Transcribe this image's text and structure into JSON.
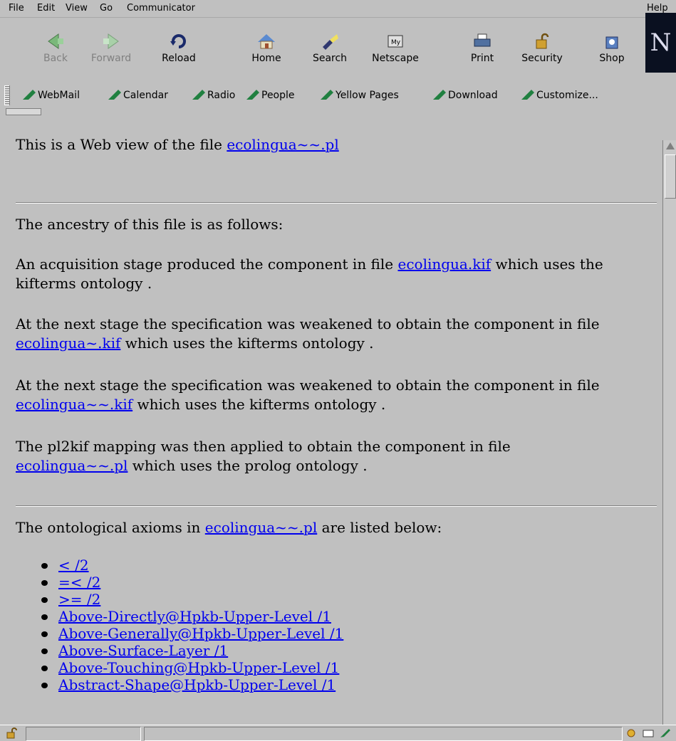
{
  "menu": [
    "File",
    "Edit",
    "View",
    "Go",
    "Communicator",
    "Help"
  ],
  "toolbar": {
    "buttons": [
      {
        "label": "Back",
        "icon": "back-arrow-icon",
        "enabled": false
      },
      {
        "label": "Forward",
        "icon": "forward-arrow-icon",
        "enabled": false
      },
      {
        "label": "Reload",
        "icon": "reload-icon",
        "enabled": true
      },
      {
        "label": "Home",
        "icon": "home-icon",
        "enabled": true
      },
      {
        "label": "Search",
        "icon": "search-flashlight-icon",
        "enabled": true
      },
      {
        "label": "Netscape",
        "icon": "my-netscape-icon",
        "enabled": true
      },
      {
        "label": "Print",
        "icon": "printer-icon",
        "enabled": true
      },
      {
        "label": "Security",
        "icon": "padlock-icon",
        "enabled": true
      },
      {
        "label": "Shop",
        "icon": "shop-bag-icon",
        "enabled": true
      }
    ],
    "logo": "N"
  },
  "personal_toolbar": [
    "WebMail",
    "Calendar",
    "Radio",
    "People",
    "Yellow Pages",
    "Download",
    "Customize..."
  ],
  "page": {
    "intro_text": "This is a Web view of the file ",
    "intro_link": "ecolingua~~.pl",
    "ancestry_heading": "The ancestry of this file is as follows:",
    "p1_a": "An acquisition stage produced the component in file ",
    "p1_link": "ecolingua.kif",
    "p1_b": " which uses the kifterms ontology .",
    "p2_a": "At the next stage the specification was weakened to obtain the component in file ",
    "p2_link": "ecolingua~.kif",
    "p2_b": " which uses the kifterms ontology .",
    "p3_a": "At the next stage the specification was weakened to obtain the component in file ",
    "p3_link": "ecolingua~~.kif",
    "p3_b": " which uses the kifterms ontology .",
    "p4_a": "The pl2kif mapping was then applied to obtain the component in file ",
    "p4_link": "ecolingua~~.pl",
    "p4_b": " which uses the prolog ontology .",
    "axioms_a": "The ontological axioms in ",
    "axioms_link": "ecolingua~~.pl",
    "axioms_b": " are listed below:",
    "axioms": [
      "< /2",
      "=< /2",
      ">= /2",
      "Above-Directly@Hpkb-Upper-Level /1",
      "Above-Generally@Hpkb-Upper-Level /1",
      "Above-Surface-Layer /1",
      "Above-Touching@Hpkb-Upper-Level /1",
      "Abstract-Shape@Hpkb-Upper-Level /1"
    ]
  }
}
